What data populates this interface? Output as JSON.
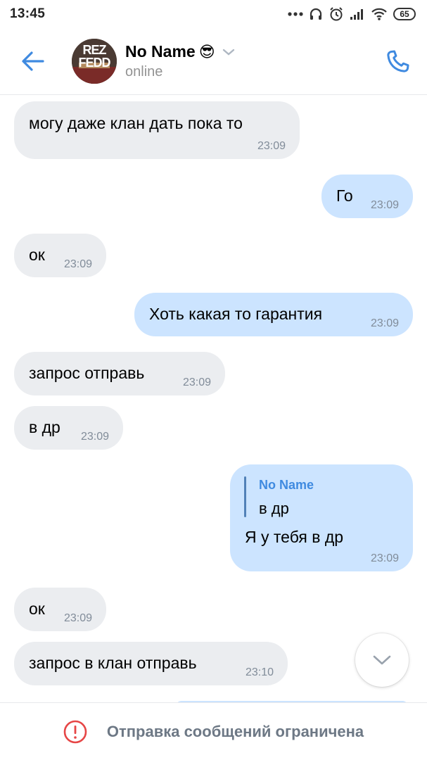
{
  "status_bar": {
    "time": "13:45",
    "battery": "65",
    "icons": [
      "dots-icon",
      "headphones-icon",
      "alarm-icon",
      "signal-icon",
      "wifi-icon",
      "battery-icon"
    ]
  },
  "header": {
    "peer_name": "No Name",
    "peer_emoji": "😎",
    "peer_status": "online",
    "avatar_text": [
      "REZ",
      "FEDD"
    ],
    "accent_color": "#3f8ae0"
  },
  "messages": [
    {
      "dir": "in",
      "text": "могу даже клан дать пока то",
      "time": "23:09"
    },
    {
      "dir": "out",
      "text": "Го",
      "time": "23:09"
    },
    {
      "dir": "in",
      "text": "ок",
      "time": "23:09"
    },
    {
      "dir": "out",
      "text": "Хоть какая то гарантия",
      "time": "23:09"
    },
    {
      "dir": "in",
      "text": "запрос отправь",
      "time": "23:09"
    },
    {
      "dir": "in",
      "text": "в др",
      "time": "23:09"
    },
    {
      "dir": "out",
      "text": "Я у тебя в др",
      "time": "23:09",
      "reply": {
        "name": "No Name",
        "text": "в др"
      }
    },
    {
      "dir": "in",
      "text": "ок",
      "time": "23:09"
    },
    {
      "dir": "in",
      "text": "запрос в клан отправь",
      "time": "23:10"
    }
  ],
  "bottom_bar": {
    "notice": "Отправка сообщений ограничена",
    "icon": "warning-icon",
    "icon_color": "#e64646"
  },
  "colors": {
    "incoming_bubble": "#ebedf0",
    "outgoing_bubble": "#cce4ff",
    "time_text": "#818c99"
  }
}
